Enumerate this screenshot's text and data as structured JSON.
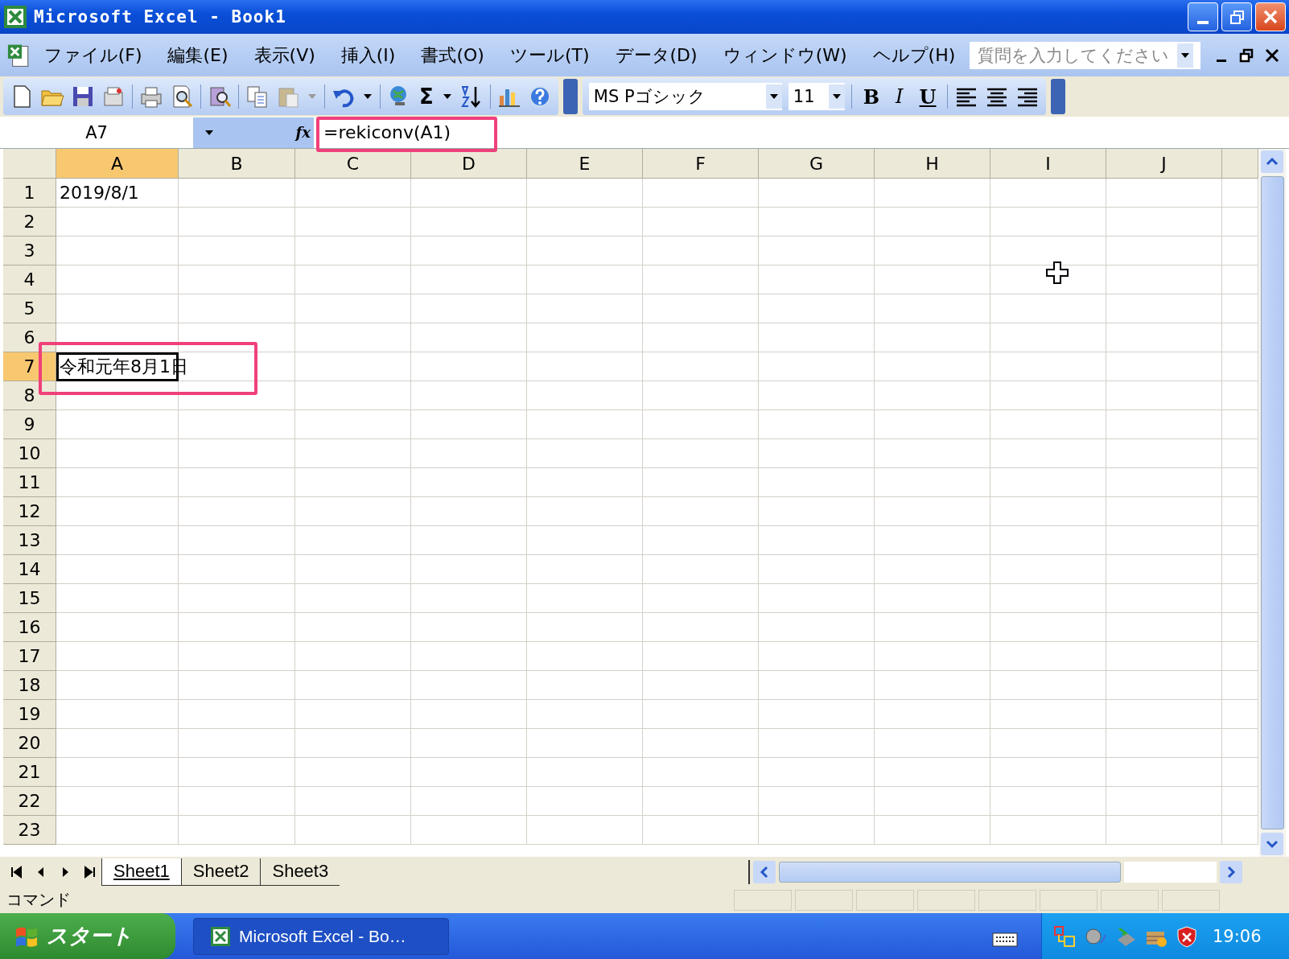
{
  "window": {
    "title": "Microsoft Excel - Book1"
  },
  "menu": [
    {
      "label": "ファイル(F)"
    },
    {
      "label": "編集(E)"
    },
    {
      "label": "表示(V)"
    },
    {
      "label": "挿入(I)"
    },
    {
      "label": "書式(O)"
    },
    {
      "label": "ツール(T)"
    },
    {
      "label": "データ(D)"
    },
    {
      "label": "ウィンドウ(W)"
    },
    {
      "label": "ヘルプ(H)"
    }
  ],
  "question_box": {
    "placeholder": "質問を入力してください"
  },
  "toolbar": {
    "sum_symbol": "Σ",
    "font": "MS Pゴシック",
    "font_size": "11",
    "format_buttons": [
      {
        "label": "B",
        "kind": "bold"
      },
      {
        "label": "I",
        "kind": "italic"
      },
      {
        "label": "U",
        "kind": "underline"
      }
    ]
  },
  "formula_bar": {
    "name_box": "A7",
    "function_label": "fx",
    "formula": "=rekiconv(A1)"
  },
  "sheet": {
    "columns": [
      {
        "label": "A",
        "selected": true
      },
      {
        "label": "B",
        "selected": false
      },
      {
        "label": "C",
        "selected": false
      },
      {
        "label": "D",
        "selected": false
      },
      {
        "label": "E",
        "selected": false
      },
      {
        "label": "F",
        "selected": false
      },
      {
        "label": "G",
        "selected": false
      },
      {
        "label": "H",
        "selected": false
      },
      {
        "label": "I",
        "selected": false
      },
      {
        "label": "J",
        "selected": false
      }
    ],
    "rows": [
      {
        "label": "1",
        "selected": false,
        "cells": [
          {
            "text": "2019/8/1",
            "selected": false
          }
        ]
      },
      {
        "label": "2",
        "selected": false
      },
      {
        "label": "3",
        "selected": false
      },
      {
        "label": "4",
        "selected": false
      },
      {
        "label": "5",
        "selected": false
      },
      {
        "label": "6",
        "selected": false
      },
      {
        "label": "7",
        "selected": true,
        "cells": [
          {
            "text": "令和元年8月1日",
            "selected": true
          }
        ]
      },
      {
        "label": "8",
        "selected": false
      },
      {
        "label": "9",
        "selected": false
      },
      {
        "label": "10",
        "selected": false
      },
      {
        "label": "11",
        "selected": false
      },
      {
        "label": "12",
        "selected": false
      },
      {
        "label": "13",
        "selected": false
      },
      {
        "label": "14",
        "selected": false
      },
      {
        "label": "15",
        "selected": false
      },
      {
        "label": "16",
        "selected": false
      },
      {
        "label": "17",
        "selected": false
      },
      {
        "label": "18",
        "selected": false
      },
      {
        "label": "19",
        "selected": false
      },
      {
        "label": "20",
        "selected": false
      },
      {
        "label": "21",
        "selected": false
      },
      {
        "label": "22",
        "selected": false
      },
      {
        "label": "23",
        "selected": false
      }
    ]
  },
  "sheet_tabs": [
    {
      "label": "Sheet1",
      "selected": true
    },
    {
      "label": "Sheet2",
      "selected": false
    },
    {
      "label": "Sheet3",
      "selected": false
    }
  ],
  "status_bar": {
    "text": "コマンド"
  },
  "taskbar": {
    "start": "スタート",
    "tasks": [
      {
        "label": "Microsoft Excel - Bo…"
      }
    ],
    "clock": "19:06"
  }
}
